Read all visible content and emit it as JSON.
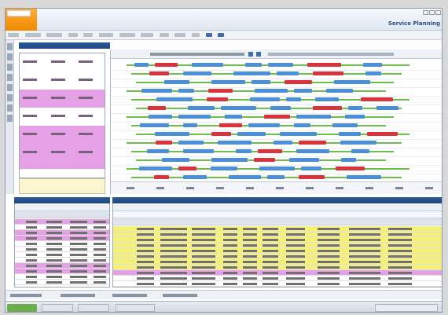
{
  "app": {
    "title": "Service Planning",
    "logo_text": ""
  },
  "panels": {
    "top_left_title": "",
    "bottom_left_title": "",
    "bottom_right_title": ""
  },
  "colors": {
    "brand_orange": "#f18a00",
    "header_blue": "#1f4680",
    "row_pink": "#e6a0e6",
    "row_yellow": "#f5f07a",
    "gantt_green": "#6bbf4a",
    "gantt_blue": "#4a8fd8",
    "gantt_red": "#d9343c"
  },
  "left_grid_rows": [
    {
      "highlight": false
    },
    {
      "highlight": false
    },
    {
      "highlight": true
    },
    {
      "highlight": false
    },
    {
      "highlight": true
    },
    {
      "highlight": true
    }
  ],
  "gantt_rows": 14,
  "bottom_left_rows": [
    {
      "highlight": "pink"
    },
    {
      "highlight": "none"
    },
    {
      "highlight": "pink"
    },
    {
      "highlight": "pink"
    },
    {
      "highlight": "none"
    },
    {
      "highlight": "none"
    },
    {
      "highlight": "none"
    },
    {
      "highlight": "none"
    },
    {
      "highlight": "pink"
    },
    {
      "highlight": "pink"
    },
    {
      "highlight": "none"
    },
    {
      "highlight": "none"
    }
  ],
  "bottom_right_rows": [
    {
      "highlight": "yellow"
    },
    {
      "highlight": "yellow"
    },
    {
      "highlight": "yellow"
    },
    {
      "highlight": "yellow"
    },
    {
      "highlight": "yellow"
    },
    {
      "highlight": "yellow"
    },
    {
      "highlight": "yellow"
    },
    {
      "highlight": "yellow"
    },
    {
      "highlight": "pink"
    },
    {
      "highlight": "none"
    },
    {
      "highlight": "none"
    }
  ]
}
